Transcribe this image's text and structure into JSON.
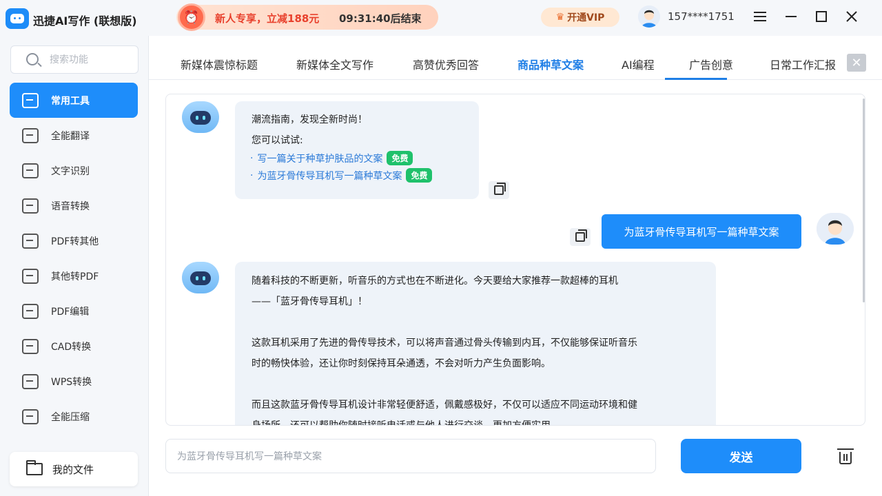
{
  "app": {
    "title": "迅捷AI写作 (联想版)"
  },
  "promo": {
    "text": "新人专享，立减188元",
    "timer": "09:31:40后结束"
  },
  "header": {
    "vip_label": "开通VIP",
    "user_phone": "157****1751"
  },
  "sidebar": {
    "search_placeholder": "搜索功能",
    "items": [
      {
        "label": "常用工具",
        "icon": "toolbox-icon",
        "active": true
      },
      {
        "label": "全能翻译",
        "icon": "translate-icon"
      },
      {
        "label": "文字识别",
        "icon": "text-recognition-icon"
      },
      {
        "label": "语音转换",
        "icon": "voice-convert-icon"
      },
      {
        "label": "PDF转其他",
        "icon": "pdf-convert-icon"
      },
      {
        "label": "其他转PDF",
        "icon": "to-pdf-icon"
      },
      {
        "label": "PDF编辑",
        "icon": "pdf-edit-icon"
      },
      {
        "label": "CAD转换",
        "icon": "cad-convert-icon"
      },
      {
        "label": "WPS转换",
        "icon": "wps-convert-icon"
      },
      {
        "label": "全能压缩",
        "icon": "compress-icon"
      }
    ],
    "my_files": "我的文件"
  },
  "tabs": [
    {
      "label": "新媒体震惊标题"
    },
    {
      "label": "新媒体全文写作"
    },
    {
      "label": "高赞优秀回答"
    },
    {
      "label": "商品种草文案",
      "active": true
    },
    {
      "label": "AI编程"
    },
    {
      "label": "广告创意"
    },
    {
      "label": "日常工作汇报"
    }
  ],
  "chat": {
    "welcome": {
      "title": "潮流指南，发现全新时尚！",
      "subtitle": "您可以试试:",
      "suggestions": [
        {
          "text": "写一篇关于种草护肤品的文案",
          "badge": "免费"
        },
        {
          "text": "为蓝牙骨传导耳机写一篇种草文案",
          "badge": "免费"
        }
      ]
    },
    "user_message": "为蓝牙骨传导耳机写一篇种草文案",
    "reply_lines": [
      "随着科技的不断更新，听音乐的方式也在不断进化。今天要给大家推荐一款超棒的耳机",
      "——「蓝牙骨传导耳机」！",
      "这款耳机采用了先进的骨传导技术，可以将声音通过骨头传输到内耳，不仅能够保证听音乐",
      "时的畅快体验，还让你时刻保持耳朵通透，不会对听力产生负面影响。",
      "而且这款蓝牙骨传导耳机设计非常轻便舒适，佩戴感极好，不仅可以适应不同运动环境和健",
      "身场所，还可以帮助你随时接听电话或与他人进行交谈，更加方便实用。"
    ]
  },
  "input": {
    "placeholder": "为蓝牙骨传导耳机写一篇种草文案",
    "send_label": "发送"
  }
}
